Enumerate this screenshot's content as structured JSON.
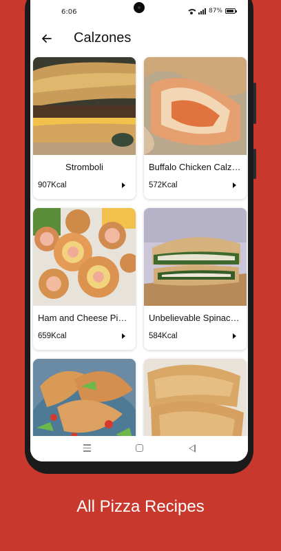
{
  "status_bar": {
    "time": "6:06",
    "battery": "87%",
    "icons": [
      "wifi-icon",
      "signal-icon",
      "battery-icon"
    ]
  },
  "app_bar": {
    "title": "Calzones",
    "back_icon": "arrow-left-icon"
  },
  "recipes": [
    {
      "name": "Stromboli",
      "kcal": "907Kcal"
    },
    {
      "name": "Buffalo Chicken Calzone",
      "kcal": "572Kcal"
    },
    {
      "name": "Ham and Cheese Pinwheels",
      "kcal": "659Kcal"
    },
    {
      "name": "Unbelievable Spinach Calzone",
      "kcal": "584Kcal"
    },
    {
      "name": "",
      "kcal": ""
    },
    {
      "name": "",
      "kcal": ""
    }
  ],
  "caption": "All Pizza Recipes",
  "colors": {
    "background": "#c8382c",
    "screen": "#ffffff",
    "text": "#111111"
  }
}
